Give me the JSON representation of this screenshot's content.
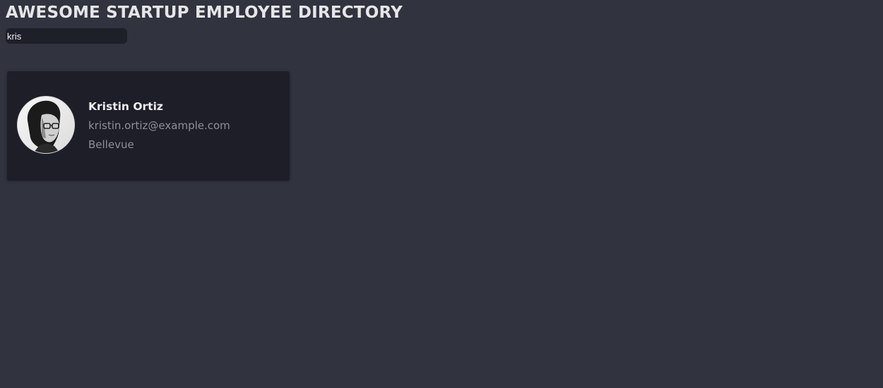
{
  "header": {
    "title": "AWESOME STARTUP EMPLOYEE DIRECTORY"
  },
  "search": {
    "value": "kris",
    "placeholder": ""
  },
  "results": [
    {
      "name": "Kristin Ortiz",
      "email": "kristin.ortiz@example.com",
      "city": "Bellevue",
      "avatar_icon": "employee-photo"
    }
  ],
  "colors": {
    "background": "#31343f",
    "card": "#1d1e28",
    "input": "#1d1f29",
    "text_primary": "#f0f0f3",
    "text_secondary": "#8e9098"
  }
}
